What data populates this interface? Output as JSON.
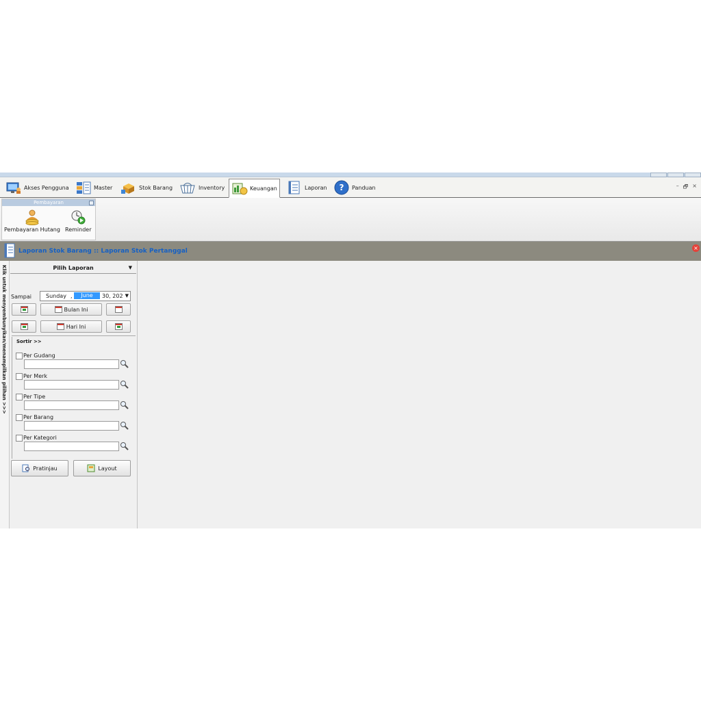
{
  "tabs": [
    {
      "label": "Akses Pengguna",
      "icon": "monitor-user-icon"
    },
    {
      "label": "Master",
      "icon": "master-list-icon"
    },
    {
      "label": "Stok Barang",
      "icon": "boxes-icon"
    },
    {
      "label": "Inventory",
      "icon": "inventory-basket-icon"
    },
    {
      "label": "Keuangan",
      "icon": "finance-icon",
      "active": true
    },
    {
      "label": "Laporan",
      "icon": "report-notebook-icon"
    },
    {
      "label": "Panduan",
      "icon": "help-icon"
    }
  ],
  "window_controls": {
    "minimize": "–",
    "restore": "🗗",
    "close": "×"
  },
  "ribbon": {
    "group_title": "Pembayaran",
    "buttons": [
      {
        "label": "Pembayaran Hutang",
        "icon": "payment-person-icon"
      },
      {
        "label": "Reminder",
        "icon": "reminder-clock-icon"
      }
    ]
  },
  "document": {
    "title": "Laporan Stok Barang :: Laporan Stok Pertanggal",
    "close_glyph": "×"
  },
  "side_strip": {
    "text": "Klik untuk menyembunyikan/menampilkan pilihan >>>"
  },
  "panel": {
    "header": "Pilih Laporan",
    "header_arrow": "▼",
    "date_label": "Sampai",
    "date": {
      "day": "Sunday",
      "comma": ",",
      "month": "June",
      "rest": "30, 202",
      "arrow": "▼"
    },
    "btn_month": "Bulan Ini",
    "btn_today": "Hari Ini",
    "cal_prev_glyph": "25",
    "cal_next_glyph": "18",
    "sort_title": "Sortir >>",
    "filters": [
      "Per Gudang",
      "Per Merk",
      "Per Tipe",
      "Per Barang",
      "Per Kategori"
    ],
    "btn_preview": "Pratinjau",
    "btn_layout": "Layout"
  },
  "colors": {
    "title_text": "#1560c4",
    "title_bar": "#8c8a7f",
    "ribbon_group_header": "#b9cbe0",
    "date_highlight": "#3399ff"
  }
}
